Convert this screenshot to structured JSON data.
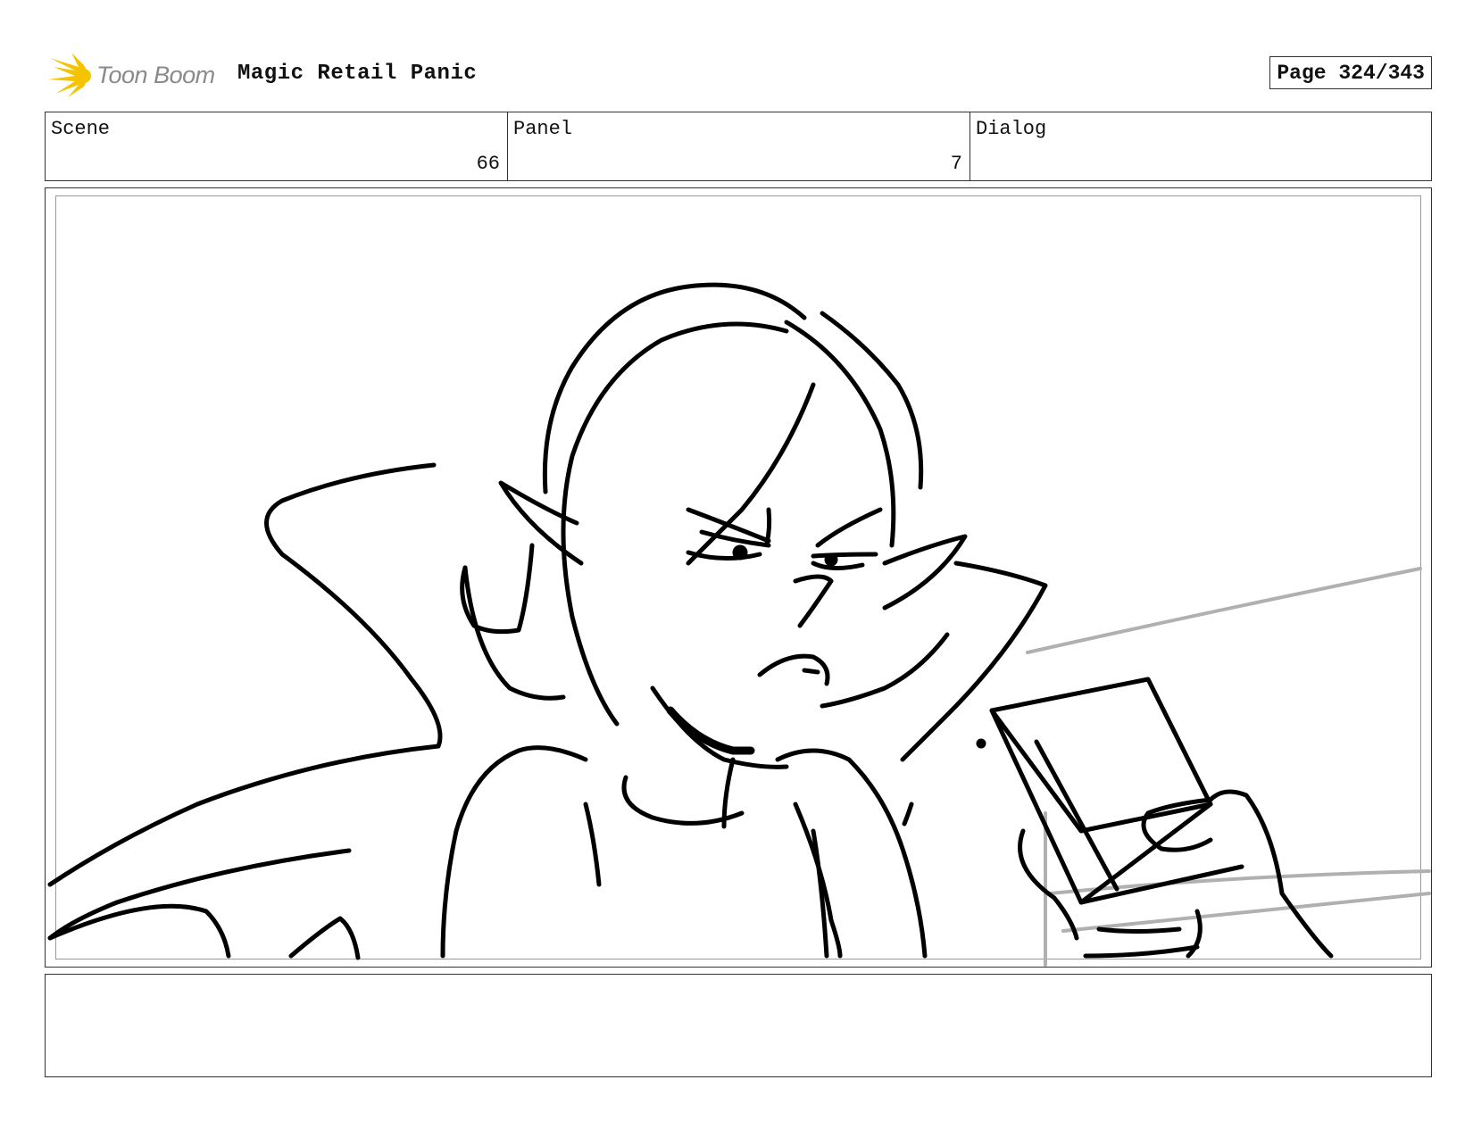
{
  "header": {
    "brand": "Toon Boom",
    "project_title": "Magic Retail Panic",
    "page": "Page 324/343"
  },
  "info": {
    "scene_label": "Scene",
    "scene_value": "66",
    "panel_label": "Panel",
    "panel_value": "7",
    "dialog_label": "Dialog",
    "dialog_value": ""
  },
  "notes": {
    "text": ""
  },
  "colors": {
    "logo_accent": "#f5c400",
    "logo_text": "#8a8a8a",
    "ink": "#000000",
    "speed_lines": "#b0b0b0"
  }
}
